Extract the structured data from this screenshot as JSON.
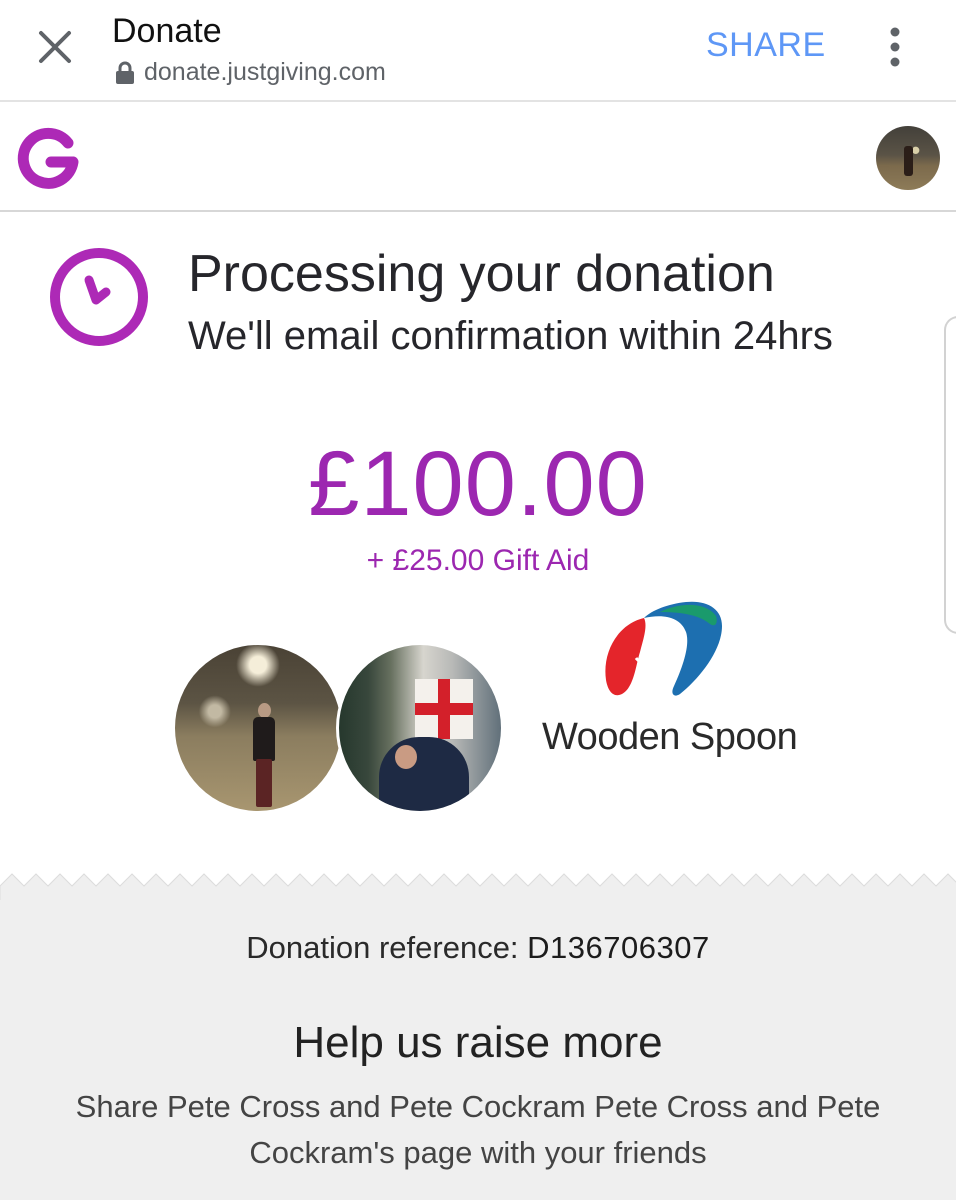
{
  "toolbar": {
    "title": "Donate",
    "url": "donate.justgiving.com",
    "share_label": "SHARE"
  },
  "status": {
    "title": "Processing your donation",
    "subtitle": "We'll email confirmation within 24hrs"
  },
  "donation": {
    "amount": "£100.00",
    "gift_aid": "+ £25.00 Gift Aid"
  },
  "charity": {
    "name": "Wooden Spoon"
  },
  "reference": {
    "label": "Donation reference: ",
    "value": "D136706307"
  },
  "share_prompt": {
    "title": "Help us raise more",
    "body": "Share Pete Cross and Pete Cockram Pete Cross and Pete Cockram's page with your friends"
  },
  "colors": {
    "brand_purple": "#9c27b0",
    "share_blue": "#5e97f6",
    "charity_red": "#e4252b",
    "charity_green": "#1a9a6c",
    "charity_blue": "#1d6fb0"
  },
  "icons": [
    "close-icon",
    "lock-icon",
    "more-vert-icon",
    "justgiving-logo-icon",
    "clock-icon"
  ]
}
